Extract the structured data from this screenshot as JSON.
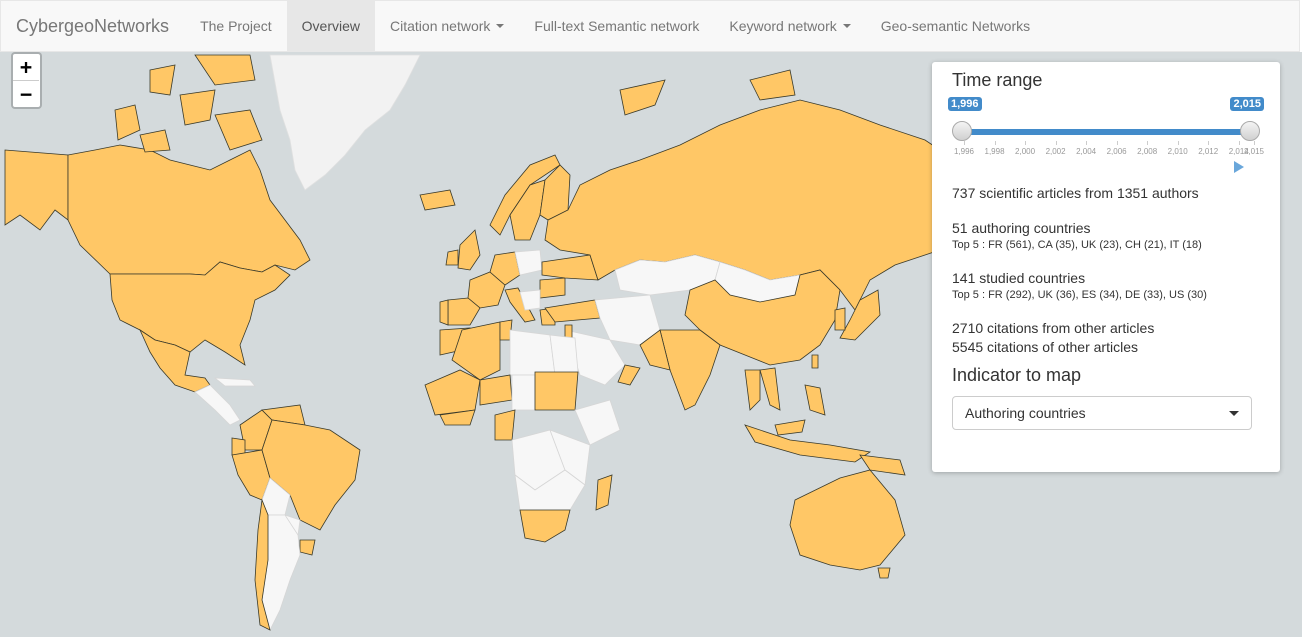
{
  "navbar": {
    "brand": "CybergeoNetworks",
    "items": [
      {
        "label": "The Project"
      },
      {
        "label": "Overview"
      },
      {
        "label": "Citation network"
      },
      {
        "label": "Full-text Semantic network"
      },
      {
        "label": "Keyword network"
      },
      {
        "label": "Geo-semantic Networks"
      }
    ]
  },
  "zoom": {
    "in_label": "+",
    "out_label": "−"
  },
  "panel": {
    "time_range_title": "Time range",
    "range_min": 1996,
    "range_max": 2015,
    "selected_from": 1996,
    "selected_to": 2015,
    "from_label": "1,996",
    "to_label": "2,015",
    "tick_labels": [
      "1,996",
      "1,998",
      "2,000",
      "2,002",
      "2,004",
      "2,006",
      "2,008",
      "2,010",
      "2,012",
      "2,014",
      "2,015"
    ],
    "articles_line": "737 scientific articles from 1351 authors",
    "authoring_countries": "51 authoring countries",
    "authoring_top5": "Top 5 : FR (561), CA (35), UK (23), CH (21), IT (18)",
    "studied_countries": "141 studied countries",
    "studied_top5": "Top 5 : FR (292), UK (36), ES (34), DE (33), US (30)",
    "citations_from": "2710 citations from other articles",
    "citations_of": "5545 citations of other articles",
    "indicator_title": "Indicator to map",
    "indicator_selected": "Authoring countries"
  },
  "map_colors": {
    "ocean": "#d4dadc",
    "highlighted_country": "#ffc766",
    "other_country": "#f7f7f7"
  }
}
